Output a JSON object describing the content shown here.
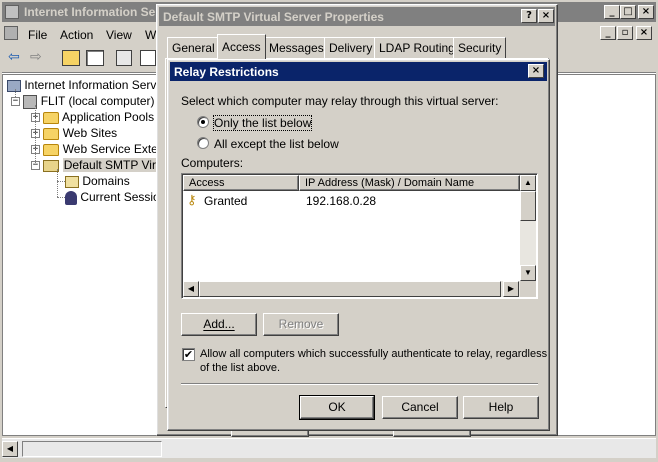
{
  "mmc": {
    "title": "Internet Information Se",
    "menu": [
      "File",
      "Action",
      "View",
      "Wi"
    ],
    "tree": [
      {
        "label": "Internet Information Servic"
      },
      {
        "label": "FLIT (local computer)"
      },
      {
        "label": "Application Pools"
      },
      {
        "label": "Web Sites"
      },
      {
        "label": "Web Service Exter"
      },
      {
        "label": "Default SMTP Virtu"
      },
      {
        "label": "Domains"
      },
      {
        "label": "Current Sessio"
      }
    ]
  },
  "props": {
    "title": "Default SMTP Virtual Server Properties",
    "tabs": [
      "General",
      "Access",
      "Messages",
      "Delivery",
      "LDAP Routing",
      "Security"
    ],
    "active_tab": "Access"
  },
  "relay": {
    "title": "Relay Restrictions",
    "prompt": "Select which computer may relay through this virtual server:",
    "radio_only": "Only the list below",
    "radio_all": "All except the list below",
    "selected": "only",
    "computers_label": "Computers:",
    "columns": [
      "Access",
      "IP Address (Mask) / Domain Name"
    ],
    "rows": [
      {
        "access": "Granted",
        "ip": "192.168.0.28"
      }
    ],
    "add_label": "Add...",
    "remove_label": "Remove",
    "allow_text_1": "Allow all computers which successfully authenticate to relay, regardless",
    "allow_text_2": "of the list above.",
    "allow_checked": true,
    "ok_label": "OK",
    "cancel_label": "Cancel",
    "help_label": "Help"
  }
}
